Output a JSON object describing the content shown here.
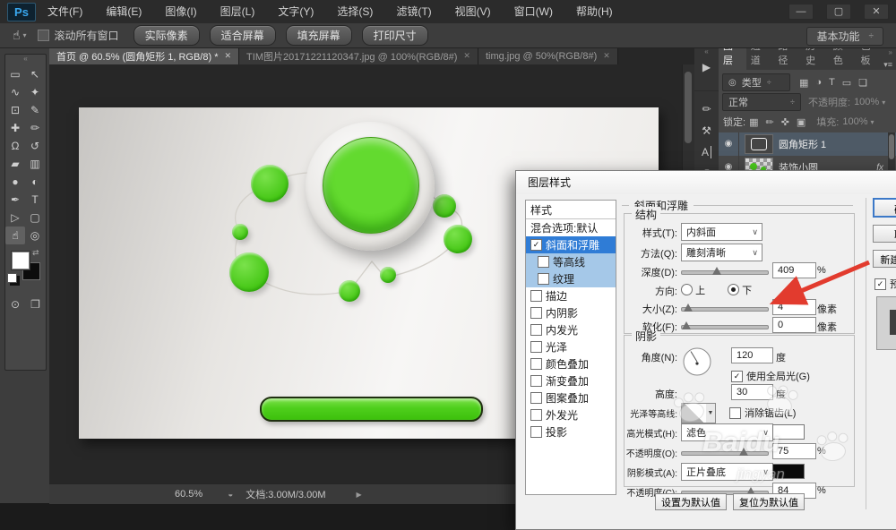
{
  "app": {
    "logo": "Ps",
    "workspace": "基本功能"
  },
  "window": {
    "minimize": "—",
    "maximize": "▢",
    "close": "✕"
  },
  "menubar": {
    "items": [
      "文件(F)",
      "编辑(E)",
      "图像(I)",
      "图层(L)",
      "文字(Y)",
      "选择(S)",
      "滤镜(T)",
      "视图(V)",
      "窗口(W)",
      "帮助(H)"
    ]
  },
  "options": {
    "scroll_all": "滚动所有窗口",
    "buttons": [
      "实际像素",
      "适合屏幕",
      "填充屏幕",
      "打印尺寸"
    ]
  },
  "tabs": {
    "items": [
      "首页 @ 60.5% (圆角矩形 1, RGB/8) *",
      "TIM图片20171221120347.jpg @ 100%(RGB/8#)",
      "timg.jpg @ 50%(RGB/8#)"
    ]
  },
  "tools": {
    "items": [
      {
        "name": "rectangular-marquee",
        "glyph": "▭"
      },
      {
        "name": "move",
        "glyph": "↖"
      },
      {
        "name": "lasso",
        "glyph": "∿"
      },
      {
        "name": "magic-wand",
        "glyph": "✦"
      },
      {
        "name": "crop",
        "glyph": "⊡"
      },
      {
        "name": "eyedropper",
        "glyph": "✎"
      },
      {
        "name": "healing-brush",
        "glyph": "✚"
      },
      {
        "name": "brush",
        "glyph": "✏"
      },
      {
        "name": "clone-stamp",
        "glyph": "Ω"
      },
      {
        "name": "history-brush",
        "glyph": "↺"
      },
      {
        "name": "eraser",
        "glyph": "▰"
      },
      {
        "name": "gradient",
        "glyph": "▥"
      },
      {
        "name": "blur",
        "glyph": "●"
      },
      {
        "name": "dodge",
        "glyph": "◐"
      },
      {
        "name": "pen",
        "glyph": "✒"
      },
      {
        "name": "type",
        "glyph": "T"
      },
      {
        "name": "path-selection",
        "glyph": "▷"
      },
      {
        "name": "shape",
        "glyph": "▢"
      },
      {
        "name": "hand",
        "glyph": "☝"
      },
      {
        "name": "zoom",
        "glyph": "◎"
      }
    ],
    "extra": [
      {
        "name": "quick-mask",
        "glyph": "⊙"
      },
      {
        "name": "screen-mode",
        "glyph": "❐"
      }
    ]
  },
  "statusbar": {
    "zoom": "60.5%",
    "doc": "文档:3.00M/3.00M"
  },
  "rightdock": {
    "strip": [
      {
        "name": "actions-panel",
        "glyph": "▶"
      },
      {
        "name": "brush-presets-panel",
        "glyph": "✏"
      },
      {
        "name": "tool-presets-panel",
        "glyph": "⚒"
      },
      {
        "name": "character-panel",
        "glyph": "A"
      },
      {
        "name": "paragraph-panel",
        "glyph": "¶"
      }
    ],
    "panel_tabs": [
      "图层",
      "通道",
      "路径",
      "历史",
      "颜色",
      "色板"
    ],
    "filter": {
      "label": "类型",
      "icons": [
        {
          "name": "filter-pixel-layers",
          "glyph": "▦"
        },
        {
          "name": "filter-adjustment-layers",
          "glyph": "◑"
        },
        {
          "name": "filter-type-layers",
          "glyph": "T"
        },
        {
          "name": "filter-shape-layers",
          "glyph": "▭"
        },
        {
          "name": "filter-smart-objects",
          "glyph": "❏"
        }
      ]
    },
    "blend": {
      "mode": "正常",
      "opacity_label": "不透明度:",
      "opacity": "100%"
    },
    "lock": {
      "label": "锁定:",
      "icons": [
        {
          "name": "lock-transparency",
          "glyph": "▦"
        },
        {
          "name": "lock-pixels",
          "glyph": "✏"
        },
        {
          "name": "lock-position",
          "glyph": "✜"
        },
        {
          "name": "lock-all",
          "glyph": "▣"
        }
      ],
      "fill_label": "填充:",
      "fill": "100%"
    },
    "layers": [
      {
        "name": "圆角矩形 1"
      },
      {
        "name": "装饰小圆",
        "badge": "fx"
      }
    ]
  },
  "dialog": {
    "title": "图层样式",
    "list_header": "样式",
    "blending": "混合选项:默认",
    "styles": [
      {
        "label": "斜面和浮雕"
      },
      {
        "label": "等高线"
      },
      {
        "label": "纹理"
      },
      {
        "label": "描边"
      },
      {
        "label": "内阴影"
      },
      {
        "label": "内发光"
      },
      {
        "label": "光泽"
      },
      {
        "label": "颜色叠加"
      },
      {
        "label": "渐变叠加"
      },
      {
        "label": "图案叠加"
      },
      {
        "label": "外发光"
      },
      {
        "label": "投影"
      }
    ],
    "bevel": {
      "header": "斜面和浮雕",
      "group": "结构",
      "style_label": "样式(T):",
      "style": "内斜面",
      "method_label": "方法(Q):",
      "method": "雕刻清晰",
      "depth_label": "深度(D):",
      "depth": "409",
      "percent": "%",
      "direction_label": "方向:",
      "up": "上",
      "down": "下",
      "size_label": "大小(Z):",
      "size": "4",
      "px": "像素",
      "soften_label": "软化(F):",
      "soften": "0"
    },
    "shading": {
      "group": "阴影",
      "angle_label": "角度(N):",
      "angle": "120",
      "deg": "度",
      "global_light": "使用全局光(G)",
      "altitude_label": "高度:",
      "altitude": "30",
      "contour_label": "光泽等高线:",
      "antialias": "消除锯齿(L)",
      "highlight_label": "高光模式(H):",
      "highlight_mode": "滤色",
      "h_opacity_label": "不透明度(O):",
      "h_opacity": "75",
      "shadow_label": "阴影模式(A):",
      "shadow_mode": "正片叠底",
      "s_opacity_label": "不透明度(C):",
      "s_opacity": "84"
    },
    "footer": {
      "set_default": "设置为默认值",
      "reset_default": "复位为默认值"
    },
    "side": {
      "ok": "确定",
      "cancel": "取消",
      "new_style": "新建样式...",
      "preview": "预览"
    }
  },
  "watermark": {
    "brand": "Baidu",
    "sub": "jingyan"
  },
  "glyphs": {
    "dropdown": "∨",
    "combo": "÷",
    "menu_arrow": "▾",
    "check": "✓",
    "eye": "◉",
    "search": "◎",
    "collapse_left": "«",
    "collapse_right": "»",
    "panel_menu": "▾≡",
    "swap": "⇄",
    "status_arrow": "▶",
    "status_icon": "◒",
    "tab_close": "✕",
    "hand": "☝",
    "hand_arrow": "▾"
  },
  "colors": {
    "accent_green": "#45cb17",
    "selection_blue": "#2f7cd6",
    "layer_row_selected": "#4e5a66"
  }
}
